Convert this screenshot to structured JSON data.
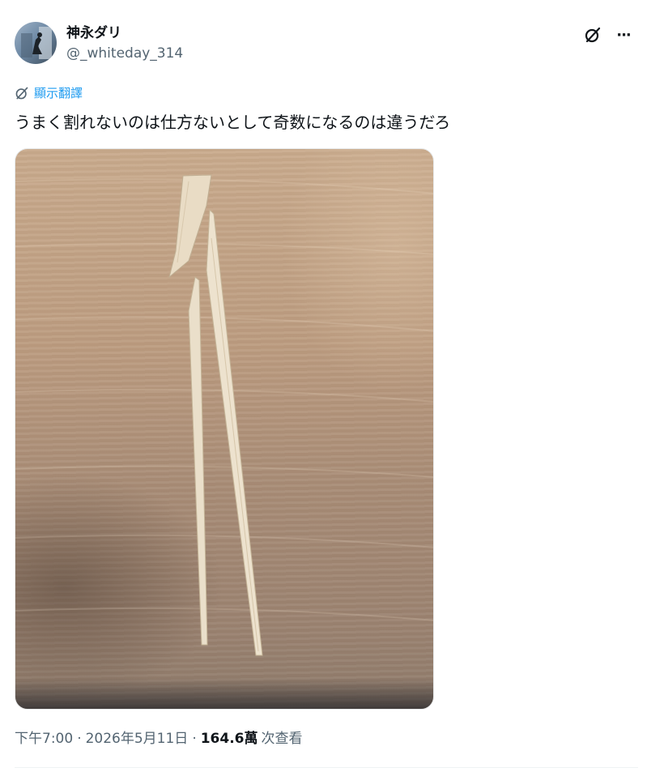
{
  "author": {
    "display_name": "神永ダリ",
    "handle": "@_whiteday_314"
  },
  "actions": {
    "grok_icon": "grok-icon",
    "more_icon": "more-icon",
    "more_glyph": "···"
  },
  "translate": {
    "label": "顯示翻譯",
    "icon": "translate-icon"
  },
  "tweet": {
    "text": "うまく割れないのは仕方ないとして奇数になるのは違うだろ"
  },
  "meta": {
    "time": "下午7:00",
    "separator": "·",
    "date": "2026年5月11日",
    "views_count": "164.6萬",
    "views_label": "次查看"
  },
  "colors": {
    "accent": "#1d9bf0",
    "text": "#0f1419",
    "secondary": "#536471"
  }
}
